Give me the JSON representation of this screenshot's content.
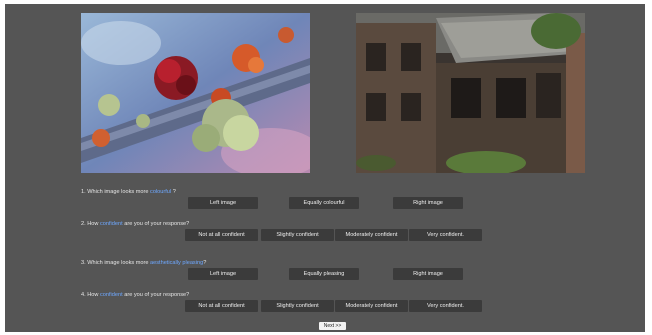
{
  "images": {
    "left": {
      "icon": "branch-with-lichen-photo"
    },
    "right": {
      "icon": "ruined-house-photo"
    }
  },
  "questions": [
    {
      "prefix": "1. Which image looks more ",
      "keyword": "colourful",
      "suffix": " ?",
      "options": [
        "Left image",
        "Equally colourful",
        "Right image"
      ]
    },
    {
      "prefix": "2. How ",
      "keyword": "confident",
      "suffix": " are you of your response?",
      "options": [
        "Not at all confident",
        "Slightly confident",
        "Moderately confident",
        "Very confident."
      ]
    },
    {
      "prefix": "3. Which image looks more ",
      "keyword": "aesthetically pleasing",
      "suffix": "?",
      "options": [
        "Left image",
        "Equally pleasing",
        "Right image"
      ]
    },
    {
      "prefix": "4. How ",
      "keyword": "confident",
      "suffix": " are you of your response?",
      "options": [
        "Not at all confident",
        "Slightly confident",
        "Moderately confident",
        "Very confident."
      ]
    }
  ],
  "next_label": "Next >>",
  "colors": {
    "background": "#555555",
    "button": "#3b3b3b",
    "keyword": "#6ea8ff"
  }
}
